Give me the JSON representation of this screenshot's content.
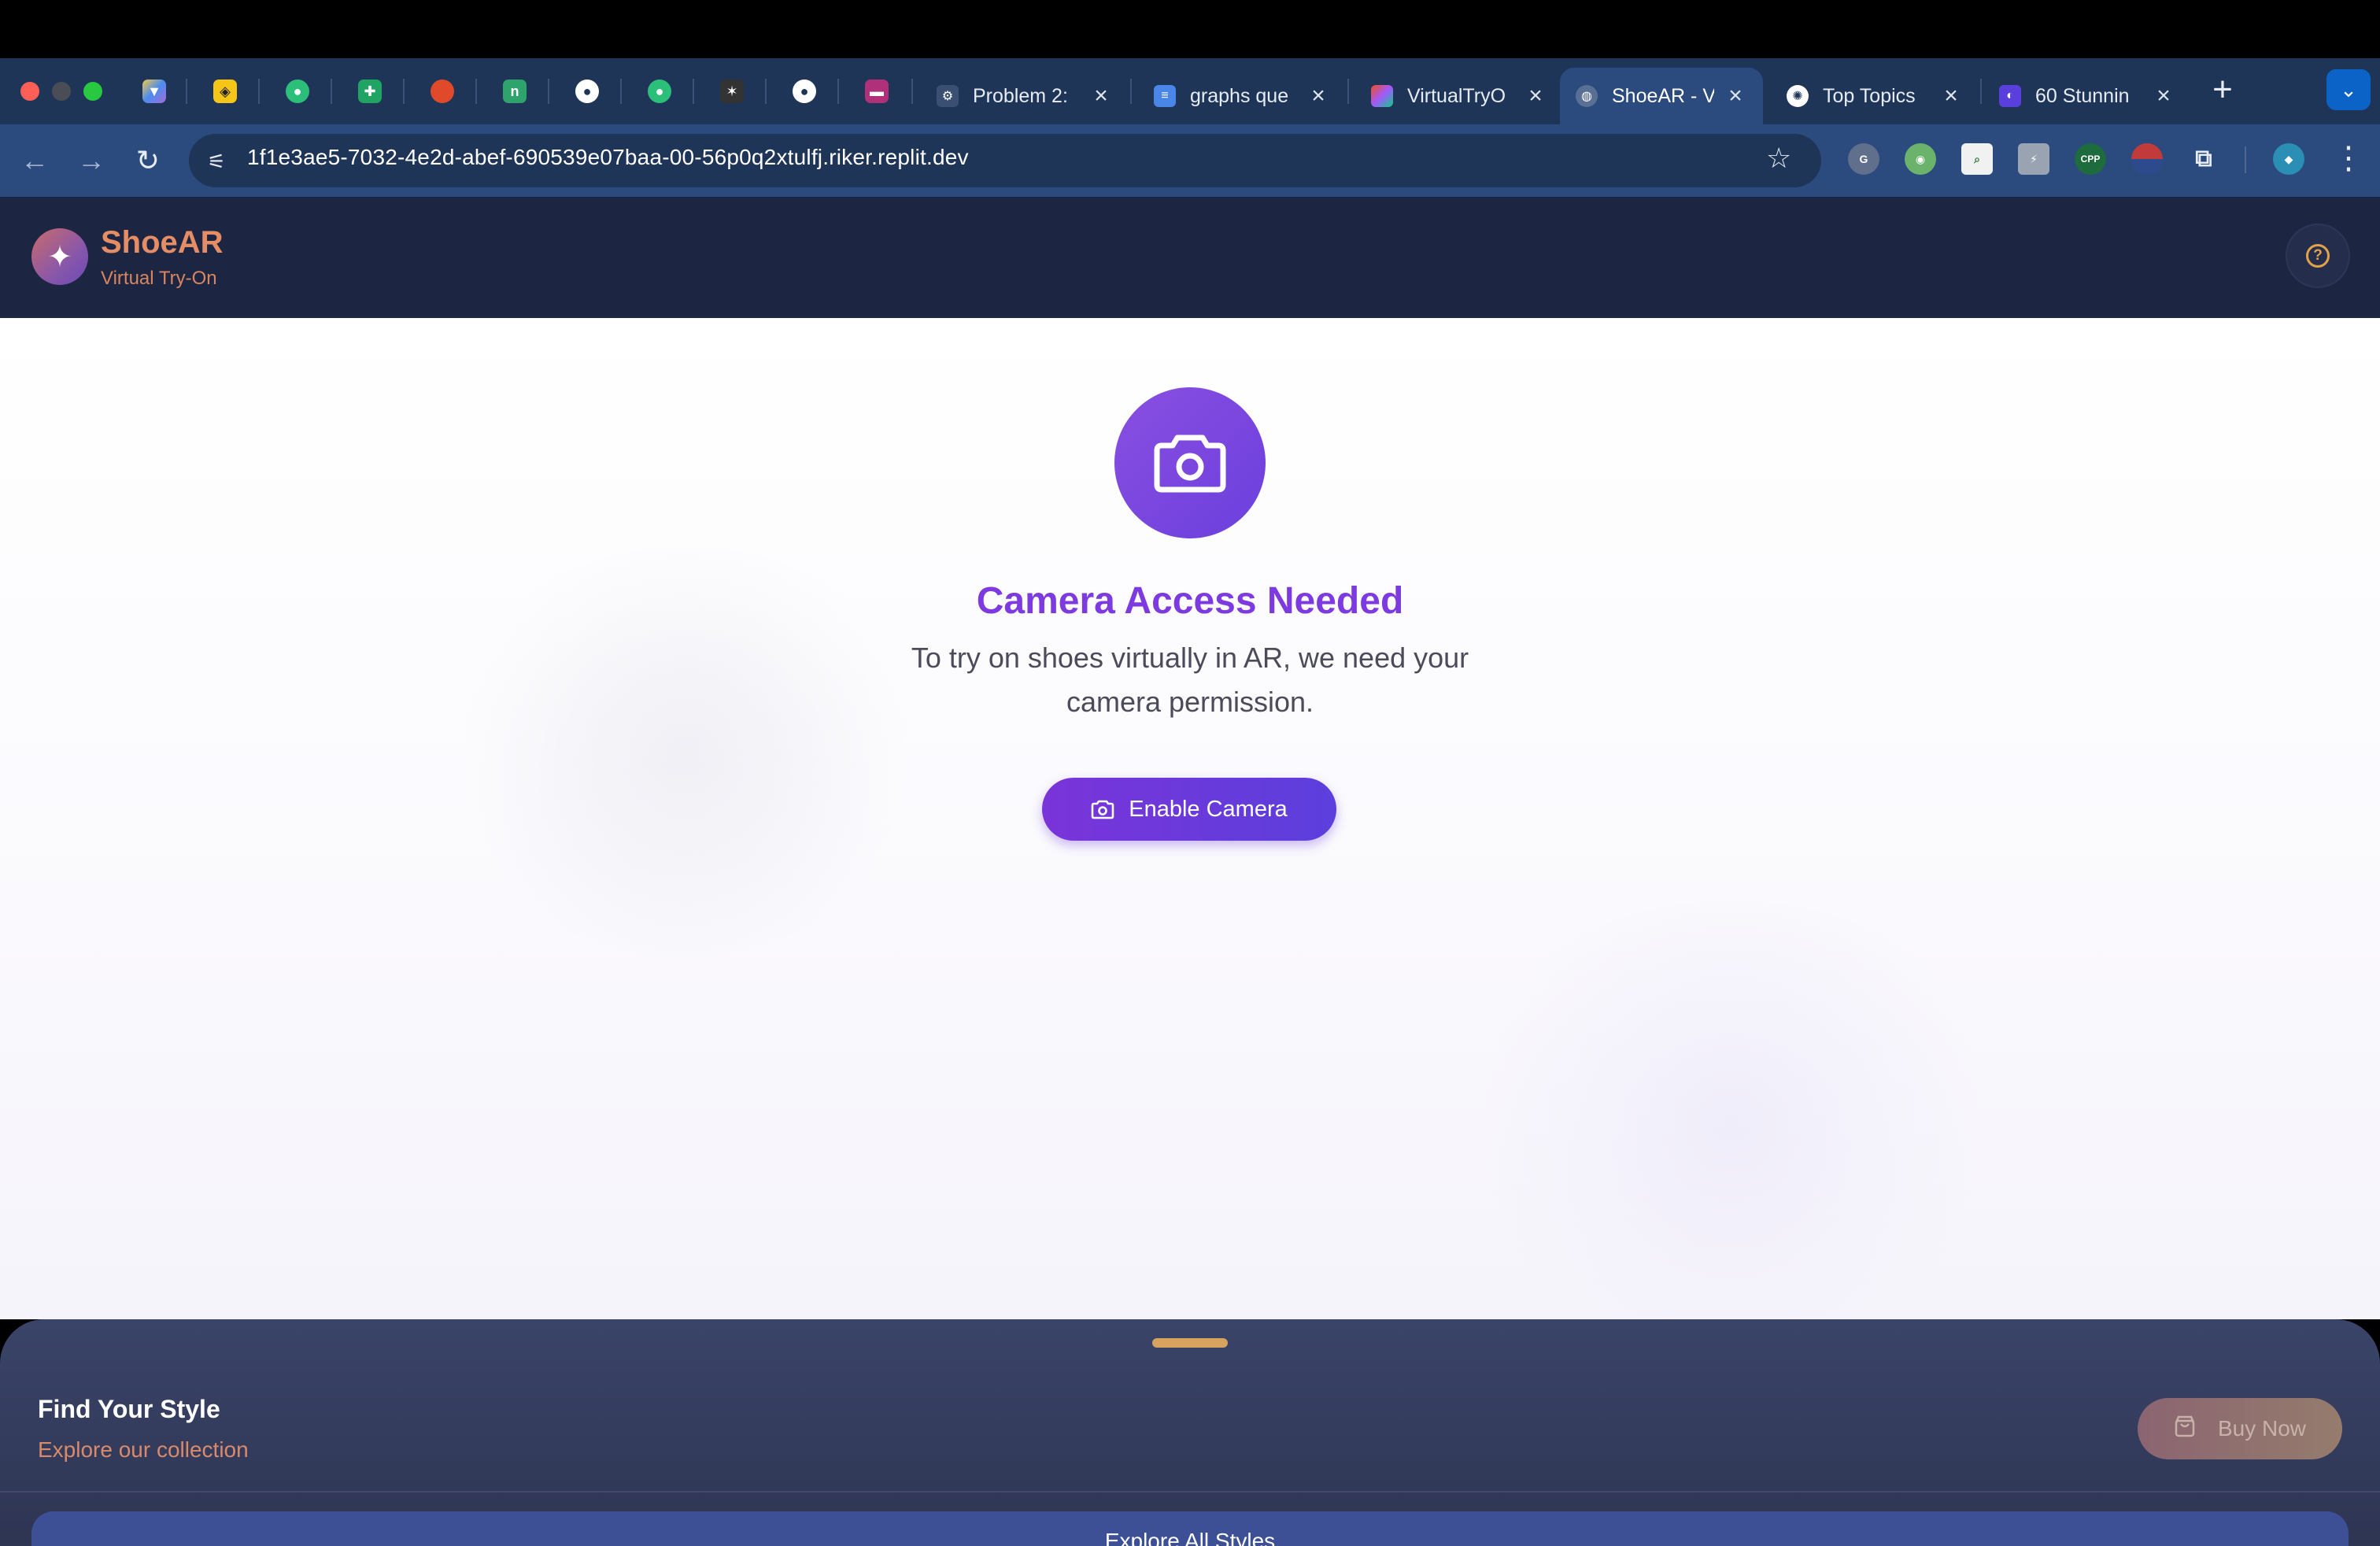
{
  "browser": {
    "tabs": [
      {
        "title": "Problem 2:",
        "favicon": "gear-favicon"
      },
      {
        "title": "graphs que",
        "favicon": "docs-favicon"
      },
      {
        "title": "VirtualTryO",
        "favicon": "figma-favicon"
      },
      {
        "title": "ShoeAR - V",
        "favicon": "globe-favicon",
        "active": true
      },
      {
        "title": "Top Topics",
        "favicon": "openai-favicon"
      },
      {
        "title": "60 Stunnin",
        "favicon": "brand-favicon"
      }
    ],
    "url": "1f1e3ae5-7032-4e2d-abef-690539e07baa-00-56p0q2xtulfj.riker.replit.dev",
    "extensions": [
      "grammarly",
      "android-ext",
      "search-ext",
      "notes-ext",
      "CPP",
      "us-flag-ext",
      "puzzle-ext",
      "profile-avatar"
    ]
  },
  "app": {
    "brand": "ShoeAR",
    "tagline": "Virtual Try-On",
    "help_icon": "help-circle-icon"
  },
  "camera_prompt": {
    "title": "Camera Access Needed",
    "description": "To try on shoes virtually in AR, we need your camera permission.",
    "button_label": "Enable Camera",
    "icon": "camera-icon"
  },
  "sheet": {
    "title": "Find Your Style",
    "subtitle": "Explore our collection",
    "buy_label": "Buy Now",
    "explore_label": "Explore All Styles"
  },
  "colors": {
    "header_bg": "#1c2541",
    "brand_orange": "#e58d64",
    "accent_purple": "#7c3ae0",
    "sheet_bg": "#3a4468"
  }
}
